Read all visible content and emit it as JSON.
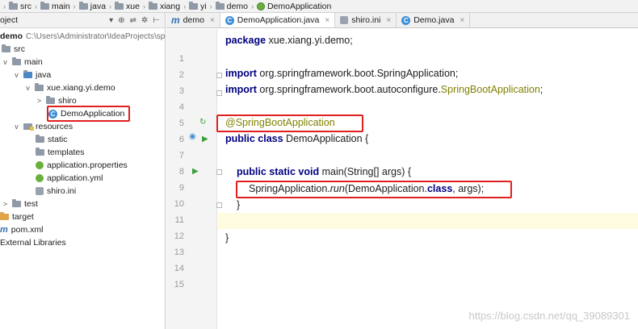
{
  "breadcrumb": [
    {
      "label": "src",
      "icon": "folder-icon"
    },
    {
      "label": "main",
      "icon": "folder-icon"
    },
    {
      "label": "java",
      "icon": "folder-icon"
    },
    {
      "label": "xue",
      "icon": "folder-icon"
    },
    {
      "label": "xiang",
      "icon": "folder-icon"
    },
    {
      "label": "yi",
      "icon": "folder-icon"
    },
    {
      "label": "demo",
      "icon": "folder-icon"
    },
    {
      "label": "DemoApplication",
      "icon": "spring-boot-icon"
    }
  ],
  "project_panel": {
    "header_title": "oject",
    "tree": [
      {
        "label": "demo",
        "suffix": "C:\\Users\\Administrator\\IdeaProjects\\sp"
      },
      {
        "label": "src"
      },
      {
        "label": "main"
      },
      {
        "label": "java"
      },
      {
        "label": "xue.xiang.yi.demo"
      },
      {
        "label": "shiro"
      },
      {
        "label": "DemoApplication"
      },
      {
        "label": "resources"
      },
      {
        "label": "static"
      },
      {
        "label": "templates"
      },
      {
        "label": "application.properties"
      },
      {
        "label": "application.yml"
      },
      {
        "label": "shiro.ini"
      },
      {
        "label": "test"
      },
      {
        "label": "target"
      },
      {
        "label": "pom.xml"
      },
      {
        "label": "External Libraries"
      }
    ]
  },
  "tabs": [
    {
      "label": "demo",
      "active": false
    },
    {
      "label": "DemoApplication.java",
      "active": true
    },
    {
      "label": "shiro.ini",
      "active": false
    },
    {
      "label": "Demo.java",
      "active": false
    }
  ],
  "editor": {
    "line_numbers": [
      "1",
      "2",
      "3",
      "4",
      "5",
      "6",
      "7",
      "8",
      "9",
      "10",
      "11",
      "12",
      "13",
      "14",
      "15"
    ],
    "code": {
      "l1_kw": "package",
      "l1_rest": " xue.xiang.yi.demo;",
      "l3_kw": "import",
      "l3_rest": " org.springframework.boot.SpringApplication;",
      "l4_kw": "import",
      "l4_rest": " org.springframework.boot.autoconfigure.",
      "l4_ann": "SpringBootApplication",
      "l4_end": ";",
      "l6_ann": "@SpringBootApplication",
      "l7_kw": "public class",
      "l7_rest": " DemoApplication {",
      "l9_kw": "public static void",
      "l9_rest": " main(String[] args) {",
      "l10_a": "SpringApplication.",
      "l10_method": "run",
      "l10_b": "(DemoApplication.",
      "l10_kw": "class",
      "l10_c": ", args);",
      "l11": "}",
      "l13": "}"
    }
  },
  "watermark": "https://blog.csdn.net/qq_39089301",
  "colors": {
    "highlight": "#e02020",
    "keyword": "#000080",
    "annotation": "#808000"
  }
}
